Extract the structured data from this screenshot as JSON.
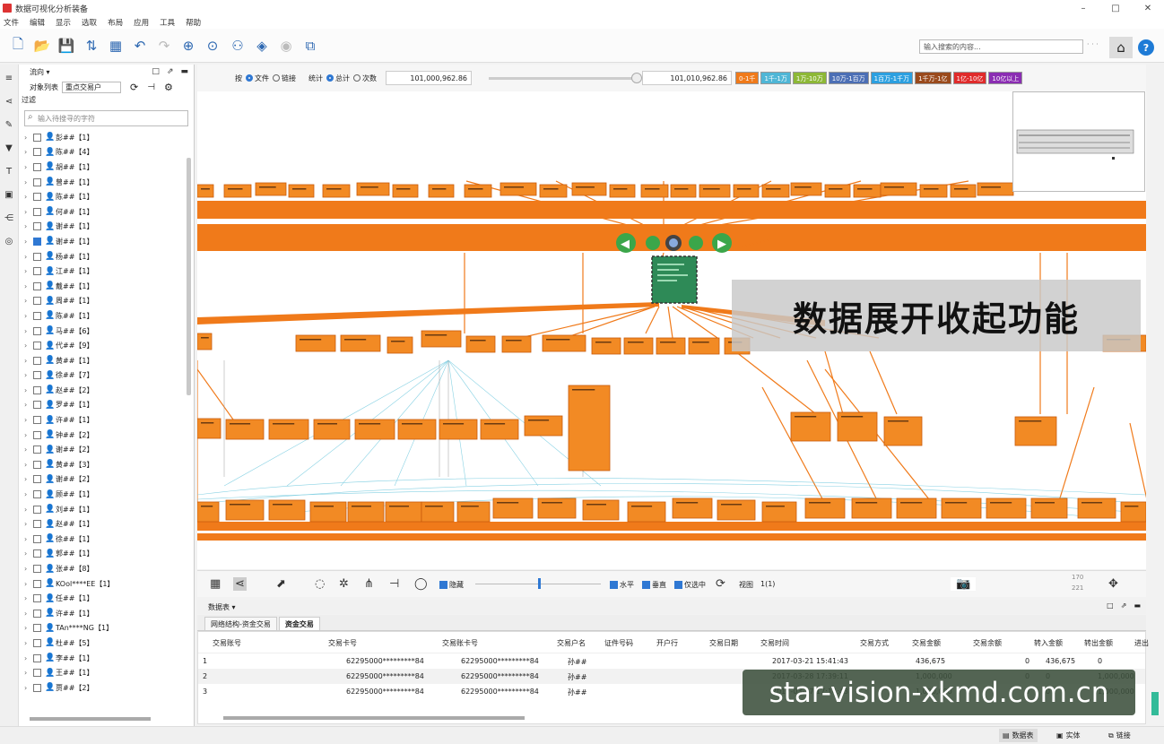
{
  "window": {
    "title": "数据可视化分析装备",
    "controls": [
      "–",
      "□",
      "✕"
    ]
  },
  "menu": [
    "文件",
    "编辑",
    "显示",
    "选取",
    "布局",
    "应用",
    "工具",
    "帮助"
  ],
  "toolbar": {
    "search_placeholder": "输入搜索的内容...",
    "dots": "· · ·"
  },
  "sidebar": {
    "direction": "流向 ▾",
    "object_list_label": "对象列表",
    "object_list_value": "重点交易户",
    "filter_label": "过滤",
    "search_placeholder": "输入待搜寻的字符",
    "items": [
      {
        "label": "彭##【1】",
        "checked": false
      },
      {
        "label": "陈##【4】",
        "checked": false
      },
      {
        "label": "胡##【1】",
        "checked": false
      },
      {
        "label": "曾##【1】",
        "checked": false
      },
      {
        "label": "陈##【1】",
        "checked": false
      },
      {
        "label": "何##【1】",
        "checked": false
      },
      {
        "label": "谢##【1】",
        "checked": false
      },
      {
        "label": "谢##【1】",
        "checked": true
      },
      {
        "label": "杨##【1】",
        "checked": false
      },
      {
        "label": "江##【1】",
        "checked": false
      },
      {
        "label": "戴##【1】",
        "checked": false
      },
      {
        "label": "周##【1】",
        "checked": false
      },
      {
        "label": "陈##【1】",
        "checked": false
      },
      {
        "label": "马##【6】",
        "checked": false
      },
      {
        "label": "代##【9】",
        "checked": false
      },
      {
        "label": "黄##【1】",
        "checked": false
      },
      {
        "label": "徐##【7】",
        "checked": false
      },
      {
        "label": "赵##【2】",
        "checked": false
      },
      {
        "label": "罗##【1】",
        "checked": false
      },
      {
        "label": "许##【1】",
        "checked": false
      },
      {
        "label": "钟##【2】",
        "checked": false
      },
      {
        "label": "谢##【2】",
        "checked": false
      },
      {
        "label": "黄##【3】",
        "checked": false
      },
      {
        "label": "谢##【2】",
        "checked": false
      },
      {
        "label": "顾##【1】",
        "checked": false
      },
      {
        "label": "刘##【1】",
        "checked": false
      },
      {
        "label": "赵##【1】",
        "checked": false
      },
      {
        "label": "徐##【1】",
        "checked": false
      },
      {
        "label": "郭##【1】",
        "checked": false
      },
      {
        "label": "张##【8】",
        "checked": false
      },
      {
        "label": "KOol****EE【1】",
        "checked": false
      },
      {
        "label": "任##【1】",
        "checked": false
      },
      {
        "label": "许##【1】",
        "checked": false
      },
      {
        "label": "TAn****NG【1】",
        "checked": false
      },
      {
        "label": "杜##【5】",
        "checked": false
      },
      {
        "label": "李##【1】",
        "checked": false
      },
      {
        "label": "王##【1】",
        "checked": false
      },
      {
        "label": "贾##【2】",
        "checked": false
      }
    ]
  },
  "graph": {
    "by_label": "按",
    "opt_text": "文件",
    "opt_link": "链接",
    "stat_label": "统计",
    "opt_total": "总计",
    "opt_count": "次数",
    "range_min": "101,000,962.86",
    "range_max": "101,010,962.86",
    "chips": [
      {
        "label": "0-1千",
        "color": "#f07a1a"
      },
      {
        "label": "1千-1万",
        "color": "#4fb6d6"
      },
      {
        "label": "1万-10万",
        "color": "#8db836"
      },
      {
        "label": "10万-1百万",
        "color": "#4c6fb5"
      },
      {
        "label": "1百万-1千万",
        "color": "#2ca0e0"
      },
      {
        "label": "1千万-1亿",
        "color": "#9a4a1c"
      },
      {
        "label": "1亿-10亿",
        "color": "#e02b2b"
      },
      {
        "label": "10亿以上",
        "color": "#8b2db3"
      }
    ],
    "caption": "数据展开收起功能"
  },
  "graph_bottom": {
    "hide_label": "隐藏",
    "horizontal": "水平",
    "vertical": "垂直",
    "select_only": "仅选中",
    "view_label": "视图",
    "view_value": "1(1)",
    "count_top": "170",
    "count_bottom": "221"
  },
  "panel": {
    "title": "数据表 ▾",
    "tabs": [
      "网络结构-资金交易",
      "资金交易"
    ],
    "columns": [
      "交易账号",
      "交易卡号",
      "交易账卡号",
      "交易户名",
      "证件号码",
      "开户行",
      "交易日期",
      "交易时间",
      "交易方式",
      "交易金额",
      "交易余额",
      "转入金额",
      "转出金额",
      "进出"
    ],
    "rows": [
      {
        "n": "1",
        "card": "62295000*********84",
        "acct": "62295000*********84",
        "name": "孙##",
        "time": "2017-03-21 15:41:43",
        "amount": "436,675",
        "balance": "0",
        "in": "436,675",
        "out": "0"
      },
      {
        "n": "2",
        "card": "62295000*********84",
        "acct": "62295000*********84",
        "name": "孙##",
        "time": "2017-03-28 17:39:11",
        "amount": "1,000,000",
        "balance": "0",
        "in": "0",
        "out": "1,000,000"
      },
      {
        "n": "3",
        "card": "62295000*********84",
        "acct": "62295000*********84",
        "name": "孙##",
        "time": "2017-03-27 17:14:43",
        "amount": "1,000,000",
        "balance": "0",
        "in": "0",
        "out": "1,000,000"
      }
    ]
  },
  "statusbar": {
    "data_table": "数据表",
    "entity": "实体",
    "link": "链接"
  },
  "watermark": "star-vision-xkmd.com.cn"
}
